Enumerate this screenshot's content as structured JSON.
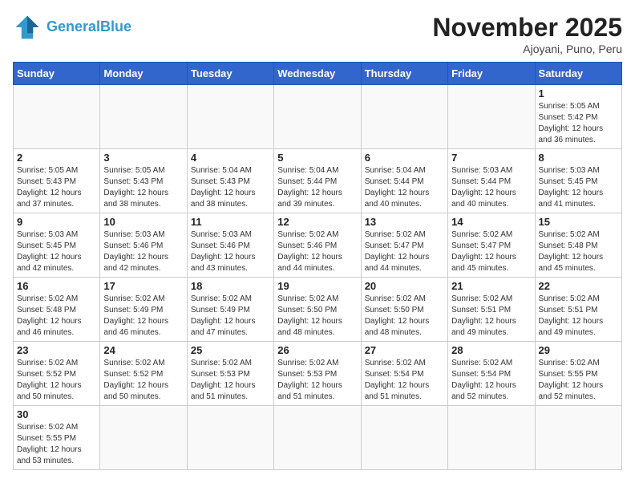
{
  "header": {
    "logo_general": "General",
    "logo_blue": "Blue",
    "month_title": "November 2025",
    "location": "Ajoyani, Puno, Peru"
  },
  "weekdays": [
    "Sunday",
    "Monday",
    "Tuesday",
    "Wednesday",
    "Thursday",
    "Friday",
    "Saturday"
  ],
  "weeks": [
    [
      {
        "day": "",
        "info": ""
      },
      {
        "day": "",
        "info": ""
      },
      {
        "day": "",
        "info": ""
      },
      {
        "day": "",
        "info": ""
      },
      {
        "day": "",
        "info": ""
      },
      {
        "day": "",
        "info": ""
      },
      {
        "day": "1",
        "info": "Sunrise: 5:05 AM\nSunset: 5:42 PM\nDaylight: 12 hours and 36 minutes."
      }
    ],
    [
      {
        "day": "2",
        "info": "Sunrise: 5:05 AM\nSunset: 5:43 PM\nDaylight: 12 hours and 37 minutes."
      },
      {
        "day": "3",
        "info": "Sunrise: 5:05 AM\nSunset: 5:43 PM\nDaylight: 12 hours and 38 minutes."
      },
      {
        "day": "4",
        "info": "Sunrise: 5:04 AM\nSunset: 5:43 PM\nDaylight: 12 hours and 38 minutes."
      },
      {
        "day": "5",
        "info": "Sunrise: 5:04 AM\nSunset: 5:44 PM\nDaylight: 12 hours and 39 minutes."
      },
      {
        "day": "6",
        "info": "Sunrise: 5:04 AM\nSunset: 5:44 PM\nDaylight: 12 hours and 40 minutes."
      },
      {
        "day": "7",
        "info": "Sunrise: 5:03 AM\nSunset: 5:44 PM\nDaylight: 12 hours and 40 minutes."
      },
      {
        "day": "8",
        "info": "Sunrise: 5:03 AM\nSunset: 5:45 PM\nDaylight: 12 hours and 41 minutes."
      }
    ],
    [
      {
        "day": "9",
        "info": "Sunrise: 5:03 AM\nSunset: 5:45 PM\nDaylight: 12 hours and 42 minutes."
      },
      {
        "day": "10",
        "info": "Sunrise: 5:03 AM\nSunset: 5:46 PM\nDaylight: 12 hours and 42 minutes."
      },
      {
        "day": "11",
        "info": "Sunrise: 5:03 AM\nSunset: 5:46 PM\nDaylight: 12 hours and 43 minutes."
      },
      {
        "day": "12",
        "info": "Sunrise: 5:02 AM\nSunset: 5:46 PM\nDaylight: 12 hours and 44 minutes."
      },
      {
        "day": "13",
        "info": "Sunrise: 5:02 AM\nSunset: 5:47 PM\nDaylight: 12 hours and 44 minutes."
      },
      {
        "day": "14",
        "info": "Sunrise: 5:02 AM\nSunset: 5:47 PM\nDaylight: 12 hours and 45 minutes."
      },
      {
        "day": "15",
        "info": "Sunrise: 5:02 AM\nSunset: 5:48 PM\nDaylight: 12 hours and 45 minutes."
      }
    ],
    [
      {
        "day": "16",
        "info": "Sunrise: 5:02 AM\nSunset: 5:48 PM\nDaylight: 12 hours and 46 minutes."
      },
      {
        "day": "17",
        "info": "Sunrise: 5:02 AM\nSunset: 5:49 PM\nDaylight: 12 hours and 46 minutes."
      },
      {
        "day": "18",
        "info": "Sunrise: 5:02 AM\nSunset: 5:49 PM\nDaylight: 12 hours and 47 minutes."
      },
      {
        "day": "19",
        "info": "Sunrise: 5:02 AM\nSunset: 5:50 PM\nDaylight: 12 hours and 48 minutes."
      },
      {
        "day": "20",
        "info": "Sunrise: 5:02 AM\nSunset: 5:50 PM\nDaylight: 12 hours and 48 minutes."
      },
      {
        "day": "21",
        "info": "Sunrise: 5:02 AM\nSunset: 5:51 PM\nDaylight: 12 hours and 49 minutes."
      },
      {
        "day": "22",
        "info": "Sunrise: 5:02 AM\nSunset: 5:51 PM\nDaylight: 12 hours and 49 minutes."
      }
    ],
    [
      {
        "day": "23",
        "info": "Sunrise: 5:02 AM\nSunset: 5:52 PM\nDaylight: 12 hours and 50 minutes."
      },
      {
        "day": "24",
        "info": "Sunrise: 5:02 AM\nSunset: 5:52 PM\nDaylight: 12 hours and 50 minutes."
      },
      {
        "day": "25",
        "info": "Sunrise: 5:02 AM\nSunset: 5:53 PM\nDaylight: 12 hours and 51 minutes."
      },
      {
        "day": "26",
        "info": "Sunrise: 5:02 AM\nSunset: 5:53 PM\nDaylight: 12 hours and 51 minutes."
      },
      {
        "day": "27",
        "info": "Sunrise: 5:02 AM\nSunset: 5:54 PM\nDaylight: 12 hours and 51 minutes."
      },
      {
        "day": "28",
        "info": "Sunrise: 5:02 AM\nSunset: 5:54 PM\nDaylight: 12 hours and 52 minutes."
      },
      {
        "day": "29",
        "info": "Sunrise: 5:02 AM\nSunset: 5:55 PM\nDaylight: 12 hours and 52 minutes."
      }
    ],
    [
      {
        "day": "30",
        "info": "Sunrise: 5:02 AM\nSunset: 5:55 PM\nDaylight: 12 hours and 53 minutes."
      },
      {
        "day": "",
        "info": ""
      },
      {
        "day": "",
        "info": ""
      },
      {
        "day": "",
        "info": ""
      },
      {
        "day": "",
        "info": ""
      },
      {
        "day": "",
        "info": ""
      },
      {
        "day": "",
        "info": ""
      }
    ]
  ]
}
